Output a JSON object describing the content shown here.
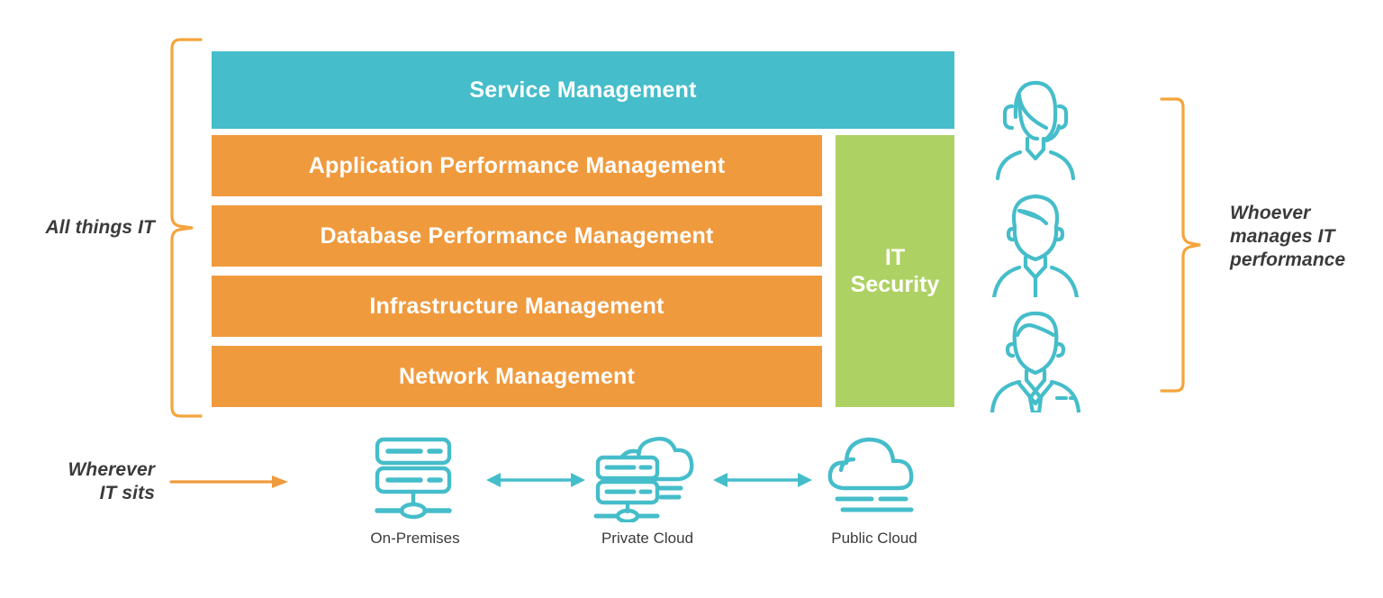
{
  "diagram": {
    "title": "All things IT management stack across deployment locations",
    "colors": {
      "teal": "#45bdca",
      "orange": "#f09a3e",
      "green": "#aed163",
      "bracket_orange": "#f4a43c",
      "text_dark": "#3b3b3b",
      "bar_text": "#ffffff",
      "background": "#ffffff"
    }
  },
  "labels": {
    "all_things_it": "All things IT",
    "whoever_manages": "Whoever\nmanages IT\nperformance",
    "whoever_manages_lines": [
      "Whoever",
      "manages IT",
      "performance"
    ],
    "wherever_it_sits": "Wherever\nIT sits",
    "wherever_it_sits_lines": [
      "Wherever",
      "IT sits"
    ]
  },
  "stack": {
    "top_bar": {
      "label": "Service Management",
      "color": "#45bdca",
      "spans_full_width": true
    },
    "rows": [
      {
        "label": "Application Performance Management",
        "color": "#f09a3e"
      },
      {
        "label": "Database Performance Management",
        "color": "#f09a3e"
      },
      {
        "label": "Infrastructure Management",
        "color": "#f09a3e"
      },
      {
        "label": "Network Management",
        "color": "#f09a3e"
      }
    ],
    "side_column": {
      "label": "IT\nSecurity",
      "label_lines": [
        "IT",
        "Security"
      ],
      "color": "#aed163"
    }
  },
  "people": [
    {
      "name": "support-agent-headset",
      "icon": "person-headset-icon"
    },
    {
      "name": "it-engineer",
      "icon": "person-casual-icon"
    },
    {
      "name": "it-manager-suit",
      "icon": "person-suit-tie-icon"
    }
  ],
  "deployment_nodes": [
    {
      "label": "On-Premises",
      "icon": "server-rack-icon"
    },
    {
      "label": "Private Cloud",
      "icon": "server-cloud-icon"
    },
    {
      "label": "Public Cloud",
      "icon": "cloud-icon"
    }
  ],
  "connectors": [
    {
      "name": "onprem-private-link",
      "type": "double-arrow",
      "color": "#45bdca"
    },
    {
      "name": "private-public-link",
      "type": "double-arrow",
      "color": "#45bdca"
    },
    {
      "name": "wherever-it-sits-arrow",
      "type": "single-arrow-right",
      "color": "#f09a3e"
    }
  ],
  "brackets": [
    {
      "name": "left-bracket",
      "orientation": "right-facing",
      "color": "#f4a43c"
    },
    {
      "name": "right-bracket",
      "orientation": "left-facing",
      "color": "#f4a43c"
    }
  ]
}
